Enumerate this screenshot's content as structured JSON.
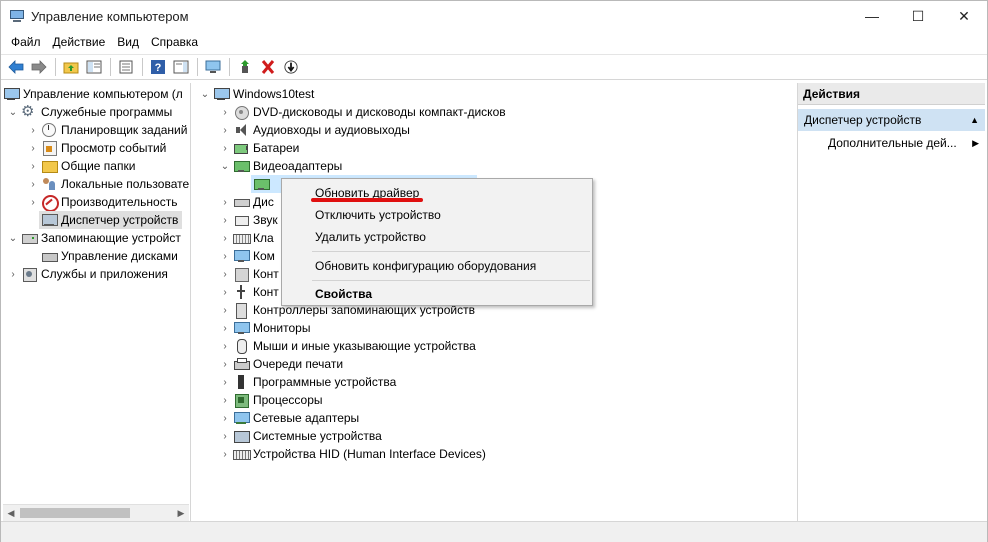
{
  "window": {
    "title": "Управление компьютером",
    "minimize": "—",
    "maximize": "☐",
    "close": "✕"
  },
  "menu": [
    "Файл",
    "Действие",
    "Вид",
    "Справка"
  ],
  "left_tree": [
    {
      "label": "Управление компьютером (л",
      "icon": "computer-management-icon",
      "expander": ""
    },
    {
      "label": "Служебные программы",
      "icon": "tools-icon",
      "expander": "⌄"
    },
    {
      "label": "Планировщик заданий",
      "icon": "clock-icon",
      "expander": "›"
    },
    {
      "label": "Просмотр событий",
      "icon": "event-viewer-icon",
      "expander": "›"
    },
    {
      "label": "Общие папки",
      "icon": "shared-folder-icon",
      "expander": "›"
    },
    {
      "label": "Локальные пользовате",
      "icon": "users-icon",
      "expander": "›"
    },
    {
      "label": "Производительность",
      "icon": "performance-icon",
      "expander": "›"
    },
    {
      "label": "Диспетчер устройств",
      "icon": "device-manager-icon",
      "expander": ""
    },
    {
      "label": "Запоминающие устройст",
      "icon": "storage-icon",
      "expander": "⌄"
    },
    {
      "label": "Управление дисками",
      "icon": "disk-icon",
      "expander": ""
    },
    {
      "label": "Службы и приложения",
      "icon": "services-icon",
      "expander": "›"
    }
  ],
  "device_tree": {
    "root": "Windows10test",
    "items": [
      {
        "label": "DVD-дисководы и дисководы компакт-дисков",
        "expander": "›"
      },
      {
        "label": "Аудиовходы и аудиовыходы",
        "expander": "›"
      },
      {
        "label": "Батареи",
        "expander": "›"
      },
      {
        "label": "Видеоадаптеры",
        "expander": "⌄"
      },
      {
        "label": "",
        "expander": ""
      },
      {
        "label": "Дис",
        "expander": "›"
      },
      {
        "label": "Звук",
        "expander": "›"
      },
      {
        "label": "Кла",
        "expander": "›"
      },
      {
        "label": "Ком",
        "expander": "›"
      },
      {
        "label": "Конт",
        "expander": "›"
      },
      {
        "label": "Конт",
        "expander": "›"
      },
      {
        "label": "Контроллеры запоминающих устройств",
        "expander": "›"
      },
      {
        "label": "Мониторы",
        "expander": "›"
      },
      {
        "label": "Мыши и иные указывающие устройства",
        "expander": "›"
      },
      {
        "label": "Очереди печати",
        "expander": "›"
      },
      {
        "label": "Программные устройства",
        "expander": "›"
      },
      {
        "label": "Процессоры",
        "expander": "›"
      },
      {
        "label": "Сетевые адаптеры",
        "expander": "›"
      },
      {
        "label": "Системные устройства",
        "expander": "›"
      },
      {
        "label": "Устройства HID (Human Interface Devices)",
        "expander": "›"
      }
    ]
  },
  "context_menu": {
    "items": [
      "Обновить драйвер",
      "Отключить устройство",
      "Удалить устройство",
      "Обновить конфигурацию оборудования",
      "Свойства"
    ],
    "highlight_color": "#e01010"
  },
  "actions": {
    "header": "Действия",
    "group": "Диспетчер устройств",
    "group_arrow": "▲",
    "sub": "Дополнительные дей...",
    "sub_arrow": "▶"
  },
  "scrollbar": {
    "left": "◀",
    "right": "▶"
  },
  "colors": {
    "selection": "#dfdfdf",
    "actions_group": "#cfe2f3",
    "accent": "#e01010"
  }
}
